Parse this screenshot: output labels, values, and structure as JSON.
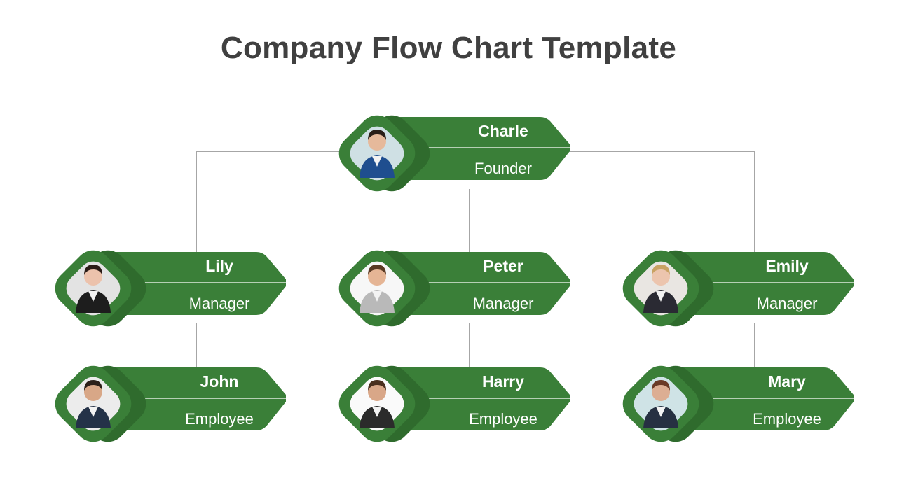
{
  "title": "Company Flow Chart Template",
  "colors": {
    "primary_green": "#3a7f38",
    "shadow_green": "#2f6b2d",
    "connector_gray": "#a6a6a6",
    "title_text": "#404040"
  },
  "org_chart": {
    "root": {
      "id": "charle",
      "name": "Charle",
      "role": "Founder",
      "photo_icon": "person-photo-man-blue-suit"
    },
    "managers": [
      {
        "id": "lily",
        "name": "Lily",
        "role": "Manager",
        "photo_icon": "person-photo-woman-dark-hair",
        "reports": [
          {
            "id": "john",
            "name": "John",
            "role": "Employee",
            "photo_icon": "person-photo-man-beard-suit"
          }
        ]
      },
      {
        "id": "peter",
        "name": "Peter",
        "role": "Manager",
        "photo_icon": "person-photo-man-gray-blazer",
        "reports": [
          {
            "id": "harry",
            "name": "Harry",
            "role": "Employee",
            "photo_icon": "person-photo-man-beard"
          }
        ]
      },
      {
        "id": "emily",
        "name": "Emily",
        "role": "Manager",
        "photo_icon": "person-photo-woman-blonde",
        "reports": [
          {
            "id": "mary",
            "name": "Mary",
            "role": "Employee",
            "photo_icon": "person-photo-woman-brown-hair"
          }
        ]
      }
    ]
  }
}
